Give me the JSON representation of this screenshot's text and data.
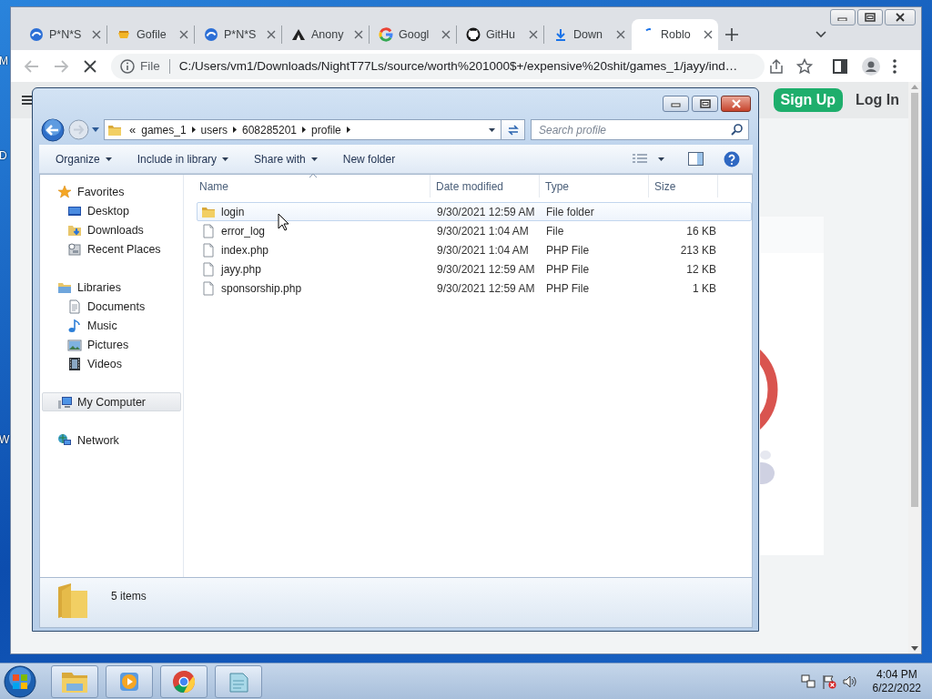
{
  "desktop": {
    "icon_labels": [
      "M",
      "D",
      "W"
    ]
  },
  "browser": {
    "tabs": [
      {
        "title": "P*N*S",
        "kind": "swirl",
        "selected": false
      },
      {
        "title": "Gofile",
        "kind": "cup",
        "selected": false
      },
      {
        "title": "P*N*S",
        "kind": "swirl",
        "selected": false
      },
      {
        "title": "Anony",
        "kind": "tent",
        "selected": false
      },
      {
        "title": "Googl",
        "kind": "ring",
        "selected": false
      },
      {
        "title": "GitHu",
        "kind": "cat",
        "selected": false
      },
      {
        "title": "Down",
        "kind": "download",
        "selected": false
      },
      {
        "title": "Roblo",
        "kind": "spinner",
        "selected": true
      }
    ],
    "address": {
      "scheme": "File",
      "url": "C:/Users/vm1/Downloads/NightT77Ls/source/worth%201000$+/expensive%20shit/games_1/jayy/ind…"
    },
    "page": {
      "buttons": [
        {
          "label": "Sign Up",
          "kind": "primary"
        },
        {
          "label": "Log In",
          "kind": "plain"
        }
      ]
    }
  },
  "explorer": {
    "breadcrumb": {
      "overflow": "«",
      "parts": [
        "games_1",
        "users",
        "608285201",
        "profile"
      ]
    },
    "search": {
      "placeholder": "Search profile"
    },
    "commands": [
      {
        "label": "Organize",
        "has_menu": true
      },
      {
        "label": "Include in library",
        "has_menu": true
      },
      {
        "label": "Share with",
        "has_menu": true
      },
      {
        "label": "New folder",
        "has_menu": false
      }
    ],
    "navigation": [
      {
        "label": "Favorites",
        "kind": "star",
        "selected": false,
        "children": [
          {
            "label": "Desktop",
            "kind": "desktop",
            "selected": false
          },
          {
            "label": "Downloads",
            "kind": "downloads",
            "selected": false
          },
          {
            "label": "Recent Places",
            "kind": "recent",
            "selected": false
          }
        ]
      },
      {
        "label": "Libraries",
        "kind": "library",
        "selected": false,
        "children": [
          {
            "label": "Documents",
            "kind": "document",
            "selected": false
          },
          {
            "label": "Music",
            "kind": "music",
            "selected": false
          },
          {
            "label": "Pictures",
            "kind": "pictures",
            "selected": false
          },
          {
            "label": "Videos",
            "kind": "videos",
            "selected": false
          }
        ]
      },
      {
        "label": "My Computer",
        "kind": "computer",
        "selected": true
      },
      {
        "label": "Network",
        "kind": "network",
        "selected": false
      }
    ],
    "columns": [
      "Name",
      "Date modified",
      "Type",
      "Size"
    ],
    "files": [
      {
        "name": "login",
        "date": "9/30/2021 12:59 AM",
        "type": "File folder",
        "kind": "folder",
        "highlighted": true
      },
      {
        "name": "error_log",
        "date": "9/30/2021 1:04 AM",
        "type": "File",
        "size": "16 KB",
        "kind": "file",
        "highlighted": false
      },
      {
        "name": "index.php",
        "date": "9/30/2021 1:04 AM",
        "type": "PHP File",
        "size": "213 KB",
        "kind": "file",
        "highlighted": false
      },
      {
        "name": "jayy.php",
        "date": "9/30/2021 12:59 AM",
        "type": "PHP File",
        "size": "12 KB",
        "kind": "file",
        "highlighted": false
      },
      {
        "name": "sponsorship.php",
        "date": "9/30/2021 12:59 AM",
        "type": "PHP File",
        "size": "1 KB",
        "kind": "file",
        "highlighted": false
      }
    ],
    "status": "5 items"
  },
  "taskbar": {
    "time": "4:04 PM",
    "date": "6/22/2022"
  }
}
